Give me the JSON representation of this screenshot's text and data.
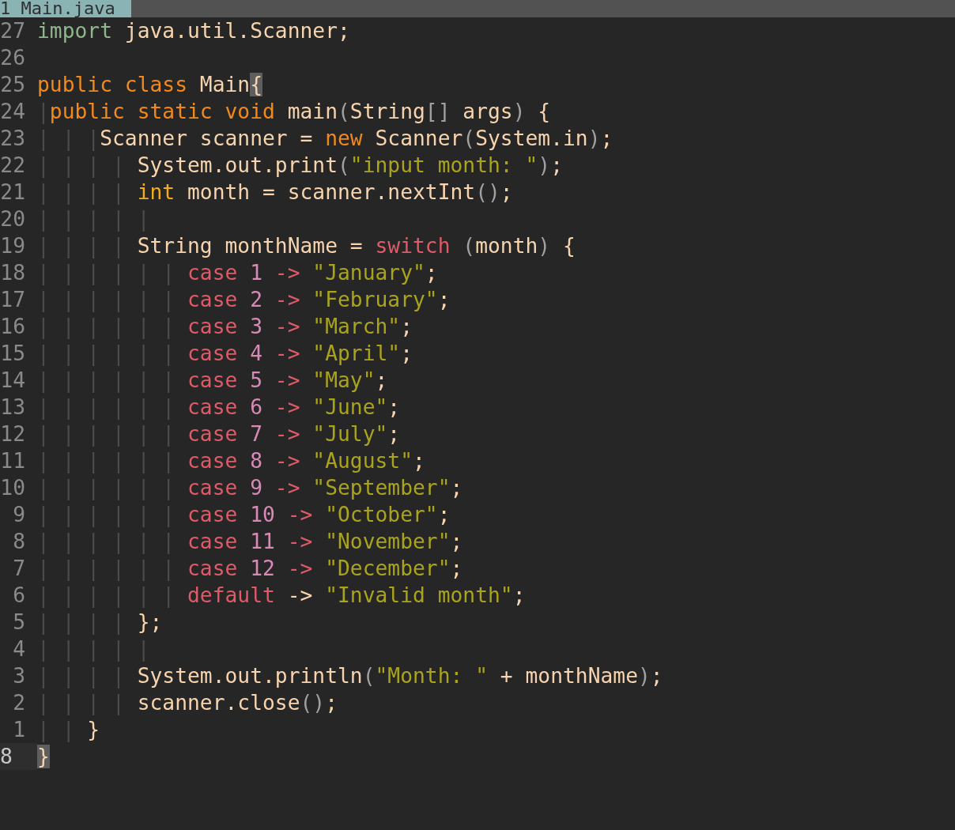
{
  "tab_bar": {
    "tabs": [
      {
        "label": "1 Main.java"
      }
    ]
  },
  "lines": [
    {
      "number": "27",
      "current": false,
      "tokens": [
        {
          "kind": "import",
          "text": "import"
        },
        {
          "kind": "plain",
          "text": " java.util.Scanner;"
        }
      ]
    },
    {
      "number": "26",
      "current": false
    },
    {
      "number": "25",
      "current": false,
      "tokens": [
        {
          "kind": "keyword",
          "text": "public class"
        },
        {
          "kind": "plain",
          "text": " Main"
        },
        {
          "kind": "match",
          "text": "{"
        }
      ]
    },
    {
      "number": "24",
      "current": false,
      "tokens": [
        {
          "kind": "guide",
          "text": "|"
        },
        {
          "kind": "keyword",
          "text": "public static void"
        },
        {
          "kind": "plain",
          "text": " main"
        },
        {
          "kind": "punct",
          "text": "("
        },
        {
          "kind": "plain",
          "text": "String"
        },
        {
          "kind": "punct",
          "text": "[]"
        },
        {
          "kind": "plain",
          "text": " args"
        },
        {
          "kind": "punct",
          "text": ")"
        },
        {
          "kind": "plain",
          "text": " {"
        }
      ]
    },
    {
      "number": "23",
      "current": false,
      "tokens": [
        {
          "kind": "guide",
          "text": "| | |"
        },
        {
          "kind": "plain",
          "text": "Scanner scanner = "
        },
        {
          "kind": "keyword",
          "text": "new"
        },
        {
          "kind": "plain",
          "text": " Scanner"
        },
        {
          "kind": "punct",
          "text": "("
        },
        {
          "kind": "plain",
          "text": "System.in"
        },
        {
          "kind": "punct",
          "text": ")"
        },
        {
          "kind": "plain",
          "text": ";"
        }
      ]
    },
    {
      "number": "22",
      "current": false,
      "tokens": [
        {
          "kind": "guide",
          "text": "| | | | "
        },
        {
          "kind": "plain",
          "text": "System.out.print"
        },
        {
          "kind": "punct",
          "text": "("
        },
        {
          "kind": "string",
          "text": "\"input month: \""
        },
        {
          "kind": "punct",
          "text": ")"
        },
        {
          "kind": "plain",
          "text": ";"
        }
      ]
    },
    {
      "number": "21",
      "current": false,
      "tokens": [
        {
          "kind": "guide",
          "text": "| | | | "
        },
        {
          "kind": "type",
          "text": "int"
        },
        {
          "kind": "plain",
          "text": " month = scanner.nextInt"
        },
        {
          "kind": "punct",
          "text": "()"
        },
        {
          "kind": "plain",
          "text": ";"
        }
      ]
    },
    {
      "number": "20",
      "current": false,
      "tokens": [
        {
          "kind": "guide",
          "text": "| | | | |"
        }
      ]
    },
    {
      "number": "19",
      "current": false,
      "tokens": [
        {
          "kind": "guide",
          "text": "| | | | "
        },
        {
          "kind": "plain",
          "text": "String monthName = "
        },
        {
          "kind": "control",
          "text": "switch"
        },
        {
          "kind": "punct",
          "text": " ("
        },
        {
          "kind": "plain",
          "text": "month"
        },
        {
          "kind": "punct",
          "text": ")"
        },
        {
          "kind": "plain",
          "text": " {"
        }
      ]
    },
    {
      "number": "18",
      "current": false,
      "tokens": [
        {
          "kind": "guide",
          "text": "| | | | | | "
        },
        {
          "kind": "control",
          "text": "case"
        },
        {
          "kind": "number",
          "text": " 1"
        },
        {
          "kind": "control",
          "text": " ->"
        },
        {
          "kind": "string",
          "text": " \"January\""
        },
        {
          "kind": "plain",
          "text": ";"
        }
      ]
    },
    {
      "number": "17",
      "current": false,
      "tokens": [
        {
          "kind": "guide",
          "text": "| | | | | | "
        },
        {
          "kind": "control",
          "text": "case"
        },
        {
          "kind": "number",
          "text": " 2"
        },
        {
          "kind": "control",
          "text": " ->"
        },
        {
          "kind": "string",
          "text": " \"February\""
        },
        {
          "kind": "plain",
          "text": ";"
        }
      ]
    },
    {
      "number": "16",
      "current": false,
      "tokens": [
        {
          "kind": "guide",
          "text": "| | | | | | "
        },
        {
          "kind": "control",
          "text": "case"
        },
        {
          "kind": "number",
          "text": " 3"
        },
        {
          "kind": "control",
          "text": " ->"
        },
        {
          "kind": "string",
          "text": " \"March\""
        },
        {
          "kind": "plain",
          "text": ";"
        }
      ]
    },
    {
      "number": "15",
      "current": false,
      "tokens": [
        {
          "kind": "guide",
          "text": "| | | | | | "
        },
        {
          "kind": "control",
          "text": "case"
        },
        {
          "kind": "number",
          "text": " 4"
        },
        {
          "kind": "control",
          "text": " ->"
        },
        {
          "kind": "string",
          "text": " \"April\""
        },
        {
          "kind": "plain",
          "text": ";"
        }
      ]
    },
    {
      "number": "14",
      "current": false,
      "tokens": [
        {
          "kind": "guide",
          "text": "| | | | | | "
        },
        {
          "kind": "control",
          "text": "case"
        },
        {
          "kind": "number",
          "text": " 5"
        },
        {
          "kind": "control",
          "text": " ->"
        },
        {
          "kind": "string",
          "text": " \"May\""
        },
        {
          "kind": "plain",
          "text": ";"
        }
      ]
    },
    {
      "number": "13",
      "current": false,
      "tokens": [
        {
          "kind": "guide",
          "text": "| | | | | | "
        },
        {
          "kind": "control",
          "text": "case"
        },
        {
          "kind": "number",
          "text": " 6"
        },
        {
          "kind": "control",
          "text": " ->"
        },
        {
          "kind": "string",
          "text": " \"June\""
        },
        {
          "kind": "plain",
          "text": ";"
        }
      ]
    },
    {
      "number": "12",
      "current": false,
      "tokens": [
        {
          "kind": "guide",
          "text": "| | | | | | "
        },
        {
          "kind": "control",
          "text": "case"
        },
        {
          "kind": "number",
          "text": " 7"
        },
        {
          "kind": "control",
          "text": " ->"
        },
        {
          "kind": "string",
          "text": " \"July\""
        },
        {
          "kind": "plain",
          "text": ";"
        }
      ]
    },
    {
      "number": "11",
      "current": false,
      "tokens": [
        {
          "kind": "guide",
          "text": "| | | | | | "
        },
        {
          "kind": "control",
          "text": "case"
        },
        {
          "kind": "number",
          "text": " 8"
        },
        {
          "kind": "control",
          "text": " ->"
        },
        {
          "kind": "string",
          "text": " \"August\""
        },
        {
          "kind": "plain",
          "text": ";"
        }
      ]
    },
    {
      "number": "10",
      "current": false,
      "tokens": [
        {
          "kind": "guide",
          "text": "| | | | | | "
        },
        {
          "kind": "control",
          "text": "case"
        },
        {
          "kind": "number",
          "text": " 9"
        },
        {
          "kind": "control",
          "text": " ->"
        },
        {
          "kind": "string",
          "text": " \"September\""
        },
        {
          "kind": "plain",
          "text": ";"
        }
      ]
    },
    {
      "number": "9",
      "current": false,
      "tokens": [
        {
          "kind": "guide",
          "text": "| | | | | | "
        },
        {
          "kind": "control",
          "text": "case"
        },
        {
          "kind": "number",
          "text": " 10"
        },
        {
          "kind": "control",
          "text": " ->"
        },
        {
          "kind": "string",
          "text": " \"October\""
        },
        {
          "kind": "plain",
          "text": ";"
        }
      ]
    },
    {
      "number": "8",
      "current": false,
      "tokens": [
        {
          "kind": "guide",
          "text": "| | | | | | "
        },
        {
          "kind": "control",
          "text": "case"
        },
        {
          "kind": "number",
          "text": " 11"
        },
        {
          "kind": "control",
          "text": " ->"
        },
        {
          "kind": "string",
          "text": " \"November\""
        },
        {
          "kind": "plain",
          "text": ";"
        }
      ]
    },
    {
      "number": "7",
      "current": false,
      "tokens": [
        {
          "kind": "guide",
          "text": "| | | | | | "
        },
        {
          "kind": "control",
          "text": "case"
        },
        {
          "kind": "number",
          "text": " 12"
        },
        {
          "kind": "control",
          "text": " ->"
        },
        {
          "kind": "string",
          "text": " \"December\""
        },
        {
          "kind": "plain",
          "text": ";"
        }
      ]
    },
    {
      "number": "6",
      "current": false,
      "tokens": [
        {
          "kind": "guide",
          "text": "| | | | | | "
        },
        {
          "kind": "control",
          "text": "default"
        },
        {
          "kind": "plain",
          "text": " ->"
        },
        {
          "kind": "string",
          "text": " \"Invalid month\""
        },
        {
          "kind": "plain",
          "text": ";"
        }
      ]
    },
    {
      "number": "5",
      "current": false,
      "tokens": [
        {
          "kind": "guide",
          "text": "| | | | "
        },
        {
          "kind": "plain",
          "text": "};"
        }
      ]
    },
    {
      "number": "4",
      "current": false,
      "tokens": [
        {
          "kind": "guide",
          "text": "| | | | |"
        }
      ]
    },
    {
      "number": "3",
      "current": false,
      "tokens": [
        {
          "kind": "guide",
          "text": "| | | | "
        },
        {
          "kind": "plain",
          "text": "System.out.println"
        },
        {
          "kind": "punct",
          "text": "("
        },
        {
          "kind": "string",
          "text": "\"Month: \""
        },
        {
          "kind": "plain",
          "text": " + monthName"
        },
        {
          "kind": "punct",
          "text": ")"
        },
        {
          "kind": "plain",
          "text": ";"
        }
      ]
    },
    {
      "number": "2",
      "current": false,
      "tokens": [
        {
          "kind": "guide",
          "text": "| | | | "
        },
        {
          "kind": "plain",
          "text": "scanner.close"
        },
        {
          "kind": "punct",
          "text": "()"
        },
        {
          "kind": "plain",
          "text": ";"
        }
      ]
    },
    {
      "number": "1",
      "current": false,
      "tokens": [
        {
          "kind": "guide",
          "text": "| | "
        },
        {
          "kind": "plain",
          "text": "}"
        }
      ]
    },
    {
      "number": "8",
      "current": true,
      "tokens": [
        {
          "kind": "match",
          "text": "}"
        }
      ]
    }
  ]
}
